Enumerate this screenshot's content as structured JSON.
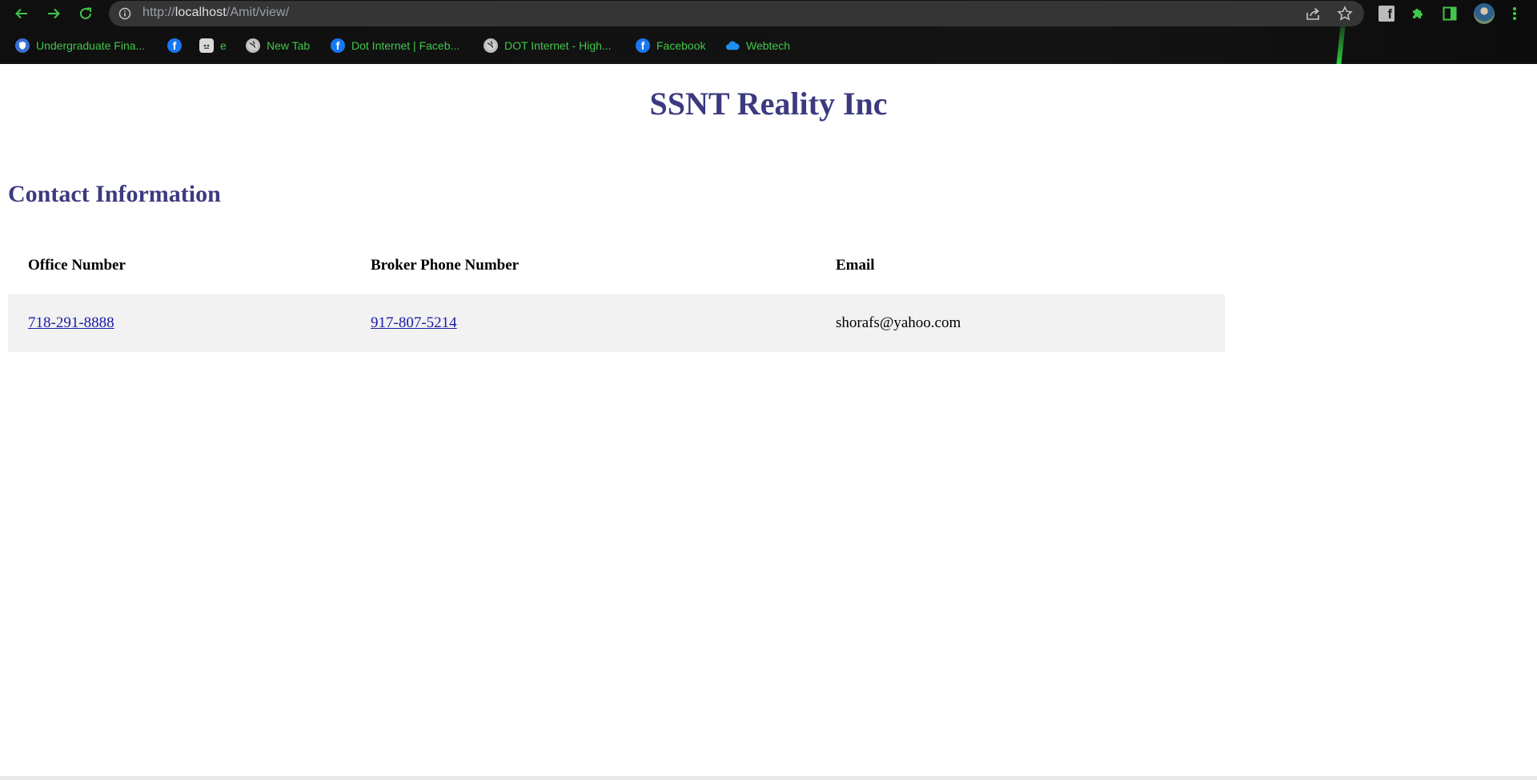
{
  "browser": {
    "url_scheme": "http://",
    "url_host": "localhost",
    "url_path": "/Amit/view/",
    "bookmarks": [
      {
        "label": "Undergraduate Fina...",
        "icon": "shield-icon"
      },
      {
        "label": "",
        "icon": "facebook-icon"
      },
      {
        "label": "e",
        "icon": "robot-icon"
      },
      {
        "label": "New Tab",
        "icon": "globe-icon"
      },
      {
        "label": "Dot Internet | Faceb...",
        "icon": "facebook-icon"
      },
      {
        "label": "DOT Internet - High...",
        "icon": "globe-icon"
      },
      {
        "label": "Facebook",
        "icon": "facebook-icon"
      },
      {
        "label": "Webtech",
        "icon": "cloud-icon"
      }
    ],
    "colors": {
      "accent": "#41c74a",
      "omnibox": "#353535",
      "frame": "#111111"
    }
  },
  "page": {
    "site_title": "SSNT Reality Inc",
    "section_title": "Contact Information",
    "table": {
      "headers": [
        "Office Number",
        "Broker Phone Number",
        "Email"
      ],
      "row": {
        "office": "718-291-8888",
        "broker": "917-807-5214",
        "email": "shorafs@yahoo.com"
      }
    },
    "colors": {
      "heading": "#3c3a7f",
      "link": "#1a1aa6",
      "row_bg": "#f2f2f2"
    }
  }
}
